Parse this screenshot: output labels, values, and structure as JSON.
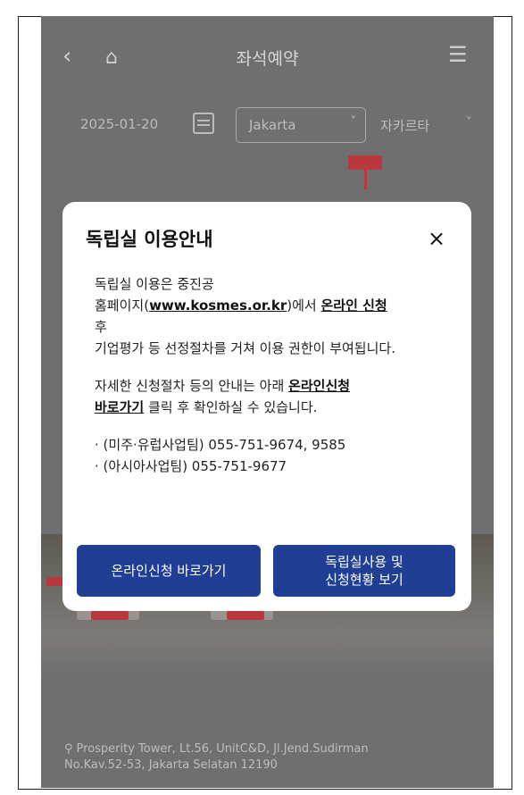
{
  "header": {
    "title": "좌석예약",
    "back_icon": "chevron-left-icon",
    "home_icon": "home-icon",
    "menu_icon": "menu-icon"
  },
  "filter": {
    "date": "2025-01-20",
    "city": "Jakarta",
    "building": "자카르타"
  },
  "footer": {
    "address_line1": "Prosperity Tower, Lt.56, UnitC&D, Jl.Jend.Sudirman",
    "address_line2": "No.Kav.52-53, Jakarta Selatan 12190"
  },
  "modal": {
    "title": "독립실 이용안내",
    "close_label": "×",
    "p1_prefix": "독립실 이용은 중진공",
    "p1_line2_a": "홈페이지(",
    "p1_link": "www.kosmes.or.kr",
    "p1_line2_b": ")에서 ",
    "p1_bold": "온라인 신청",
    "p1_line3": "후",
    "p1_line4": "기업평가 등 선정절차를 거쳐 이용 권한이 부여됩니다.",
    "p2_line1": "자세한 신청절차 등의 안내는 아래 ",
    "p2_bold1": "온라인신청",
    "p2_bold2": "바로가기",
    "p2_line2": " 클릭 후 확인하실 수 있습니다.",
    "contact1": "· (미주·유럽사업팀) 055-751-9674, 9585",
    "contact2": "· (아시아사업팀) 055-751-9677",
    "btn_online": "온라인신청 바로가기",
    "btn_status_line1": "독립실사용 및",
    "btn_status_line2": "신청현황 보기"
  },
  "colors": {
    "overlay": "#6f6f6f",
    "button_bg": "#1f3e94",
    "accent_red": "#b8383d"
  }
}
